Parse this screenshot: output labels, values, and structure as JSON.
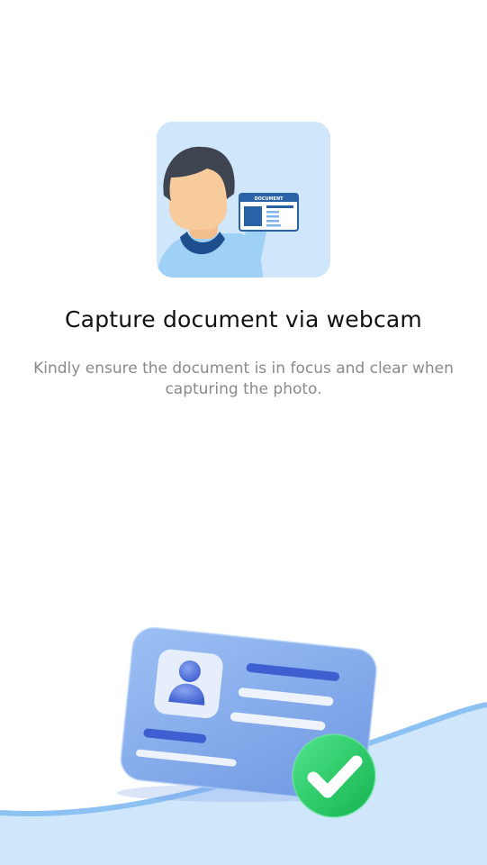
{
  "main": {
    "title": "Capture document via webcam",
    "subtitle": "Kindly ensure the document is in focus and clear when capturing the photo.",
    "illustration": {
      "icon": "person-holding-document-icon",
      "card_label": "DOCUMENT"
    },
    "bottom_illustration": {
      "icon": "id-card-verified-icon",
      "check_icon": "checkmark-icon"
    }
  },
  "colors": {
    "background": "#ffffff",
    "illustration_bg": "#cfe6fb",
    "title": "#111111",
    "subtitle": "#8a8a8a",
    "card_blue": "#7fa8ea",
    "check_green": "#2ed16a",
    "wave": "#cfe6fb"
  }
}
